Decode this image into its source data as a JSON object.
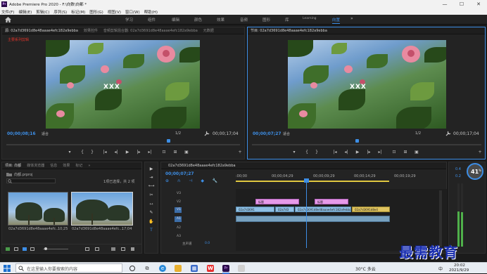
{
  "titlebar": {
    "app_title": "Adobe Premiere Pro 2020 - F:\\向数\\向都 *",
    "logo": "Pr",
    "minimize": "—",
    "maximize": "☐",
    "close": "✕"
  },
  "menu": [
    "文件(F)",
    "编辑(E)",
    "剪辑(C)",
    "序列(S)",
    "标记(M)",
    "图形(G)",
    "视图(V)",
    "窗口(W)",
    "帮助(H)"
  ],
  "workspaces": {
    "items": [
      "学习",
      "组件",
      "编辑",
      "颜色",
      "效果",
      "音频",
      "图形",
      "库",
      "Learning",
      "向置"
    ],
    "active": "向置",
    "more": "»"
  },
  "source": {
    "tabs": [
      "源: 02a7d3691d8e48aaae4efc182a9ebba",
      "效果控件",
      "音频剪辑混合器: 02a7d3691d8e48aaae4efc182a9ebba",
      "元数据"
    ],
    "subtitle": "主要系列剪辑",
    "watermark": "XXX",
    "timecode": "00;00;08;16",
    "fit": "适合",
    "ratio": "1/2",
    "duration": "00;00;17;04",
    "controls": [
      "▾",
      "{",
      "}",
      "|◂",
      "◂|",
      "▶",
      "|▸",
      "▸|",
      "⊡",
      "⊞",
      "▣",
      "+"
    ]
  },
  "program": {
    "tabs": [
      "节目: 02a7d3691d8e48aaae4efc182a9ebba"
    ],
    "watermark": "XXX",
    "timecode": "00;00;07;27",
    "fit": "适合",
    "ratio": "1/2",
    "duration": "00;00;17;04",
    "controls": [
      "▾",
      "{",
      "}",
      "|◂",
      "◂|",
      "▶",
      "|▸",
      "▸|",
      "⊡",
      "⊞",
      "▣",
      "+"
    ]
  },
  "project": {
    "tabs": [
      "项目: 向都",
      "媒体浏览器",
      "信息",
      "效果",
      "标记"
    ],
    "more": "»",
    "path": "向都.prproj",
    "selection": "1项已选择，共 2 项",
    "items": [
      {
        "name": "02a7d3691d8e48aaae4efc...",
        "duration": "10;25"
      },
      {
        "name": "02a7d3691d8e48aaae4efc...",
        "duration": "17;04"
      }
    ]
  },
  "timeline": {
    "sequence": "02a7d3691d8e48aaae4efc182a9ebba",
    "timecode": "00;00;07;27",
    "ruler": [
      ":00;00",
      "00;00;04;29",
      "00;00;09;29",
      "00;00;14;29",
      "00;00;19;29"
    ],
    "tracks": [
      "V3",
      "V2",
      "V1",
      "A1",
      "A2",
      "A3"
    ],
    "master_label": "主声道",
    "master_value": "0.0",
    "clips": {
      "v2a": "标题",
      "v2b": "标题",
      "v1a": "02a7d3691",
      "v1b": "02a7d3",
      "v1c": "02a7d3691d8e48aaae4efc182a9ebba",
      "v1d": "02a7d3691d8e4"
    }
  },
  "meter": {
    "value_a": "0.4",
    "value_b": "0.2",
    "percent": "41",
    "percent_unit": "%"
  },
  "watermark_brand": "最需教育",
  "taskbar": {
    "search_placeholder": "在这里输入你要搜索的内容",
    "weather": "30°C 多云",
    "time": "20:02",
    "date": "2021/9/29",
    "ime": "中"
  },
  "colors": {
    "accent": "#3d8ee6",
    "subtitle": "#e0342a",
    "clip_video": "#8ec0e4",
    "clip_pink": "#e69ae8",
    "brand": "#1a2fb0"
  }
}
